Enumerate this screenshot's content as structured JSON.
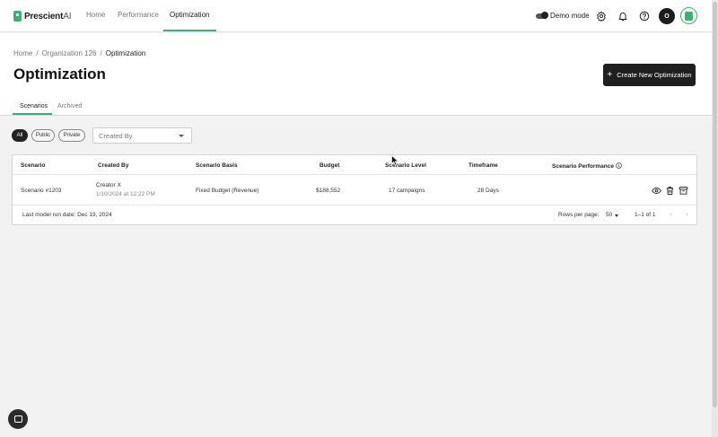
{
  "brand": {
    "name": "Prescient",
    "suffix": "AI"
  },
  "nav": {
    "home": "Home",
    "performance": "Performance",
    "optimization": "Optimization"
  },
  "topbar": {
    "demo_mode": "Demo mode",
    "avatar_initial": "O"
  },
  "breadcrumb": {
    "item1": "Home",
    "sep": "/",
    "item2": "Organization 126",
    "item3": "Optimization"
  },
  "page": {
    "title": "Optimization",
    "create_button": "Create New Optimization"
  },
  "tabs": {
    "scenarios": "Scenarios",
    "archived": "Archived"
  },
  "filters": {
    "all": "All",
    "public": "Public",
    "private": "Private",
    "created_by_placeholder": "Created By"
  },
  "table": {
    "headers": {
      "scenario": "Scenario",
      "created_by": "Created By",
      "basis": "Scenario Basis",
      "budget": "Budget",
      "level": "Scenario Level",
      "timeframe": "Timeframe",
      "performance": "Scenario Performance"
    },
    "rows": [
      {
        "scenario": "Scenario #1203",
        "creator": "Creator X",
        "created_at": "1/10/2024 at 12:22 PM",
        "basis": "Fixed Budget (Revenue)",
        "budget": "$188,552",
        "level": "17 campaigns",
        "timeframe": "28 Days"
      }
    ],
    "footer": {
      "last_run": "Last model run date: Dec 19, 2024",
      "rows_per_page_label": "Rows per page:",
      "rows_per_page_value": "50",
      "range": "1–1 of 1"
    }
  },
  "colors": {
    "accent": "#3bb273",
    "dark": "#1f1f1f"
  },
  "icons": [
    "settings-gear-icon",
    "bell-icon",
    "help-icon",
    "info-icon",
    "eye-icon",
    "trash-icon",
    "archive-icon",
    "chevron-left-icon",
    "chevron-right-icon",
    "chat-icon"
  ]
}
